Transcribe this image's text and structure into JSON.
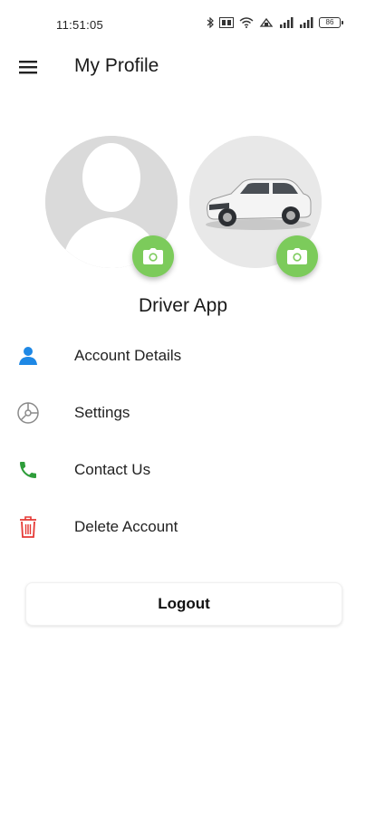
{
  "status_bar": {
    "time": "11:51:05",
    "battery": "86"
  },
  "header": {
    "title": "My Profile"
  },
  "profile": {
    "name": "Driver App"
  },
  "menu": {
    "items": [
      {
        "label": "Account Details",
        "icon": "person-icon",
        "color": "#1e88e5"
      },
      {
        "label": "Settings",
        "icon": "settings-icon",
        "color": "#8a8a8a"
      },
      {
        "label": "Contact Us",
        "icon": "phone-icon",
        "color": "#2e9d3a"
      },
      {
        "label": "Delete Account",
        "icon": "trash-icon",
        "color": "#e53935"
      }
    ]
  },
  "actions": {
    "logout_label": "Logout"
  },
  "colors": {
    "camera_button": "#7ccb5b",
    "avatar_bg": "#dadada"
  }
}
